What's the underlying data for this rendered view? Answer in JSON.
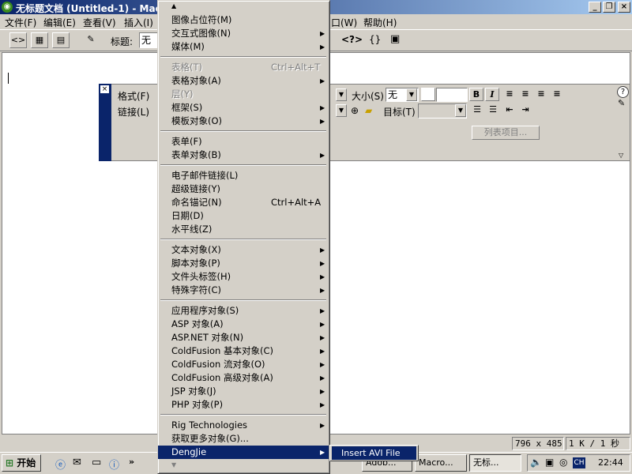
{
  "window": {
    "title": "无标题文档 (Untitled-1) - Macro"
  },
  "menubar": {
    "items_left": [
      "文件(F)",
      "编辑(E)",
      "查看(V)",
      "插入(I)"
    ],
    "items_right": [
      "口(W)",
      "帮助(H)"
    ]
  },
  "toolbar": {
    "title_label": "标题:",
    "title_value": "无标"
  },
  "property_inspector": {
    "format_label": "格式(F)",
    "link_label": "链接(L)",
    "size_label": "大小(S)",
    "size_value": "无",
    "target_label": "目标(T)",
    "list_button": "列表项目..."
  },
  "menu": {
    "scroll_up": "▲",
    "scroll_down": "▼",
    "items": [
      {
        "label": "图像占位符(M)"
      },
      {
        "label": "交互式图像(N)",
        "submenu": true
      },
      {
        "label": "媒体(M)",
        "submenu": true
      },
      {
        "label": "表格(T)",
        "shortcut": "Ctrl+Alt+T",
        "disabled": true
      },
      {
        "label": "表格对象(A)",
        "submenu": true
      },
      {
        "label": "层(Y)",
        "disabled": true
      },
      {
        "label": "框架(S)",
        "submenu": true
      },
      {
        "label": "模板对象(O)",
        "submenu": true
      },
      {
        "label": "表单(F)"
      },
      {
        "label": "表单对象(B)",
        "submenu": true
      },
      {
        "label": "电子邮件链接(L)"
      },
      {
        "label": "超级链接(Y)"
      },
      {
        "label": "命名锚记(N)",
        "shortcut": "Ctrl+Alt+A"
      },
      {
        "label": "日期(D)"
      },
      {
        "label": "水平线(Z)"
      },
      {
        "label": "文本对象(X)",
        "submenu": true
      },
      {
        "label": "脚本对象(P)",
        "submenu": true
      },
      {
        "label": "文件头标签(H)",
        "submenu": true
      },
      {
        "label": "特殊字符(C)",
        "submenu": true
      },
      {
        "label": "应用程序对象(S)",
        "submenu": true
      },
      {
        "label": "ASP 对象(A)",
        "submenu": true
      },
      {
        "label": "ASP.NET 对象(N)",
        "submenu": true
      },
      {
        "label": "ColdFusion 基本对象(C)",
        "submenu": true
      },
      {
        "label": "ColdFusion 流对象(O)",
        "submenu": true
      },
      {
        "label": "ColdFusion 高级对象(A)",
        "submenu": true
      },
      {
        "label": "JSP 对象(J)",
        "submenu": true
      },
      {
        "label": "PHP 对象(P)",
        "submenu": true
      },
      {
        "label": "Rig Technologies",
        "submenu": true
      },
      {
        "label": "获取更多对象(G)..."
      },
      {
        "label": "DengJie",
        "submenu": true,
        "highlighted": true
      }
    ]
  },
  "submenu": {
    "item": "Insert AVI File"
  },
  "statusbar": {
    "size": "796 x 485",
    "download": "1 K / 1 秒"
  },
  "taskbar": {
    "start": "开始",
    "tasks": [
      "Adob...",
      "Macro...",
      "无标..."
    ],
    "tray_lang": "CH",
    "clock": "22:44"
  }
}
